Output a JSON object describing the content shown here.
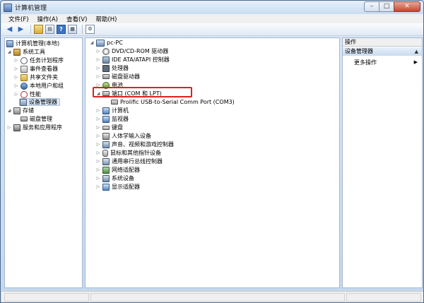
{
  "window": {
    "title": "计算机管理"
  },
  "menu": [
    "文件(F)",
    "操作(A)",
    "查看(V)",
    "帮助(H)"
  ],
  "toolbar": {
    "buttons": [
      "back-icon",
      "forward-icon",
      "up-folder-icon",
      "show-hide-tree-icon",
      "help-icon",
      "properties-icon",
      "show-hidden-icon"
    ]
  },
  "left_tree": {
    "root": "计算机管理(本地)",
    "system_tools": "系统工具",
    "items": [
      {
        "label": "任务计划程序",
        "icon": "clock-icon"
      },
      {
        "label": "事件查看器",
        "icon": "event-log-icon"
      },
      {
        "label": "共享文件夹",
        "icon": "folder-icon"
      },
      {
        "label": "本地用户和组",
        "icon": "users-icon"
      },
      {
        "label": "性能",
        "icon": "performance-icon"
      },
      {
        "label": "设备管理器",
        "icon": "device-manager-icon"
      }
    ],
    "storage": "存储",
    "disk_management": "磁盘管理",
    "services_apps": "服务和应用程序"
  },
  "device_tree": {
    "computer_name": "pc-PC",
    "categories": [
      {
        "label": "DVD/CD-ROM 驱动器",
        "icon": "dvd-icon"
      },
      {
        "label": "IDE ATA/ATAPI 控制器",
        "icon": "ide-icon"
      },
      {
        "label": "处理器",
        "icon": "cpu-icon"
      },
      {
        "label": "磁盘驱动器",
        "icon": "disk-icon"
      },
      {
        "label": "电池",
        "icon": "battery-icon"
      },
      {
        "label": "端口 (COM 和 LPT)",
        "icon": "port-icon"
      },
      {
        "label": "计算机",
        "icon": "computer-icon"
      },
      {
        "label": "监视器",
        "icon": "monitor-icon"
      },
      {
        "label": "键盘",
        "icon": "keyboard-icon"
      },
      {
        "label": "人体学输入设备",
        "icon": "hid-icon"
      },
      {
        "label": "声音、视频和游戏控制器",
        "icon": "sound-icon"
      },
      {
        "label": "鼠标和其他指针设备",
        "icon": "mouse-icon"
      },
      {
        "label": "通用串行总线控制器",
        "icon": "usb-icon"
      },
      {
        "label": "网络适配器",
        "icon": "network-icon"
      },
      {
        "label": "系统设备",
        "icon": "system-icon"
      },
      {
        "label": "显示适配器",
        "icon": "display-icon"
      }
    ],
    "port_child": "Prolific USB-to-Serial Comm Port (COM3)"
  },
  "actions": {
    "header": "操作",
    "section": "设备管理器",
    "more": "更多操作"
  }
}
